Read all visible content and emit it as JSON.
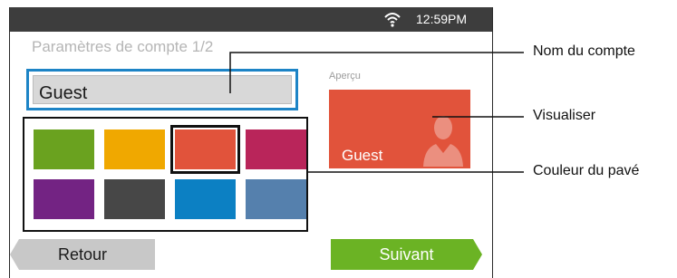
{
  "status_bar": {
    "time": "12:59PM",
    "icon": "wifi-icon"
  },
  "screen": {
    "title": "Paramètres de compte 1/2",
    "name_field": {
      "value": "Guest"
    },
    "preview": {
      "label": "Aperçu",
      "tile_name": "Guest",
      "tile_color": "#e1533b",
      "icon": "user-silhouette-icon"
    },
    "color_palette": [
      "#6aa21f",
      "#f0a800",
      "#e1533b",
      "#b9255a",
      "#732383",
      "#474747",
      "#0c80c3",
      "#5580ad"
    ],
    "selected_color_index": 2,
    "buttons": {
      "back": "Retour",
      "next": "Suivant"
    }
  },
  "callouts": {
    "account_name": "Nom du compte",
    "preview": "Visualiser",
    "tile_color": "Couleur du pavé"
  }
}
